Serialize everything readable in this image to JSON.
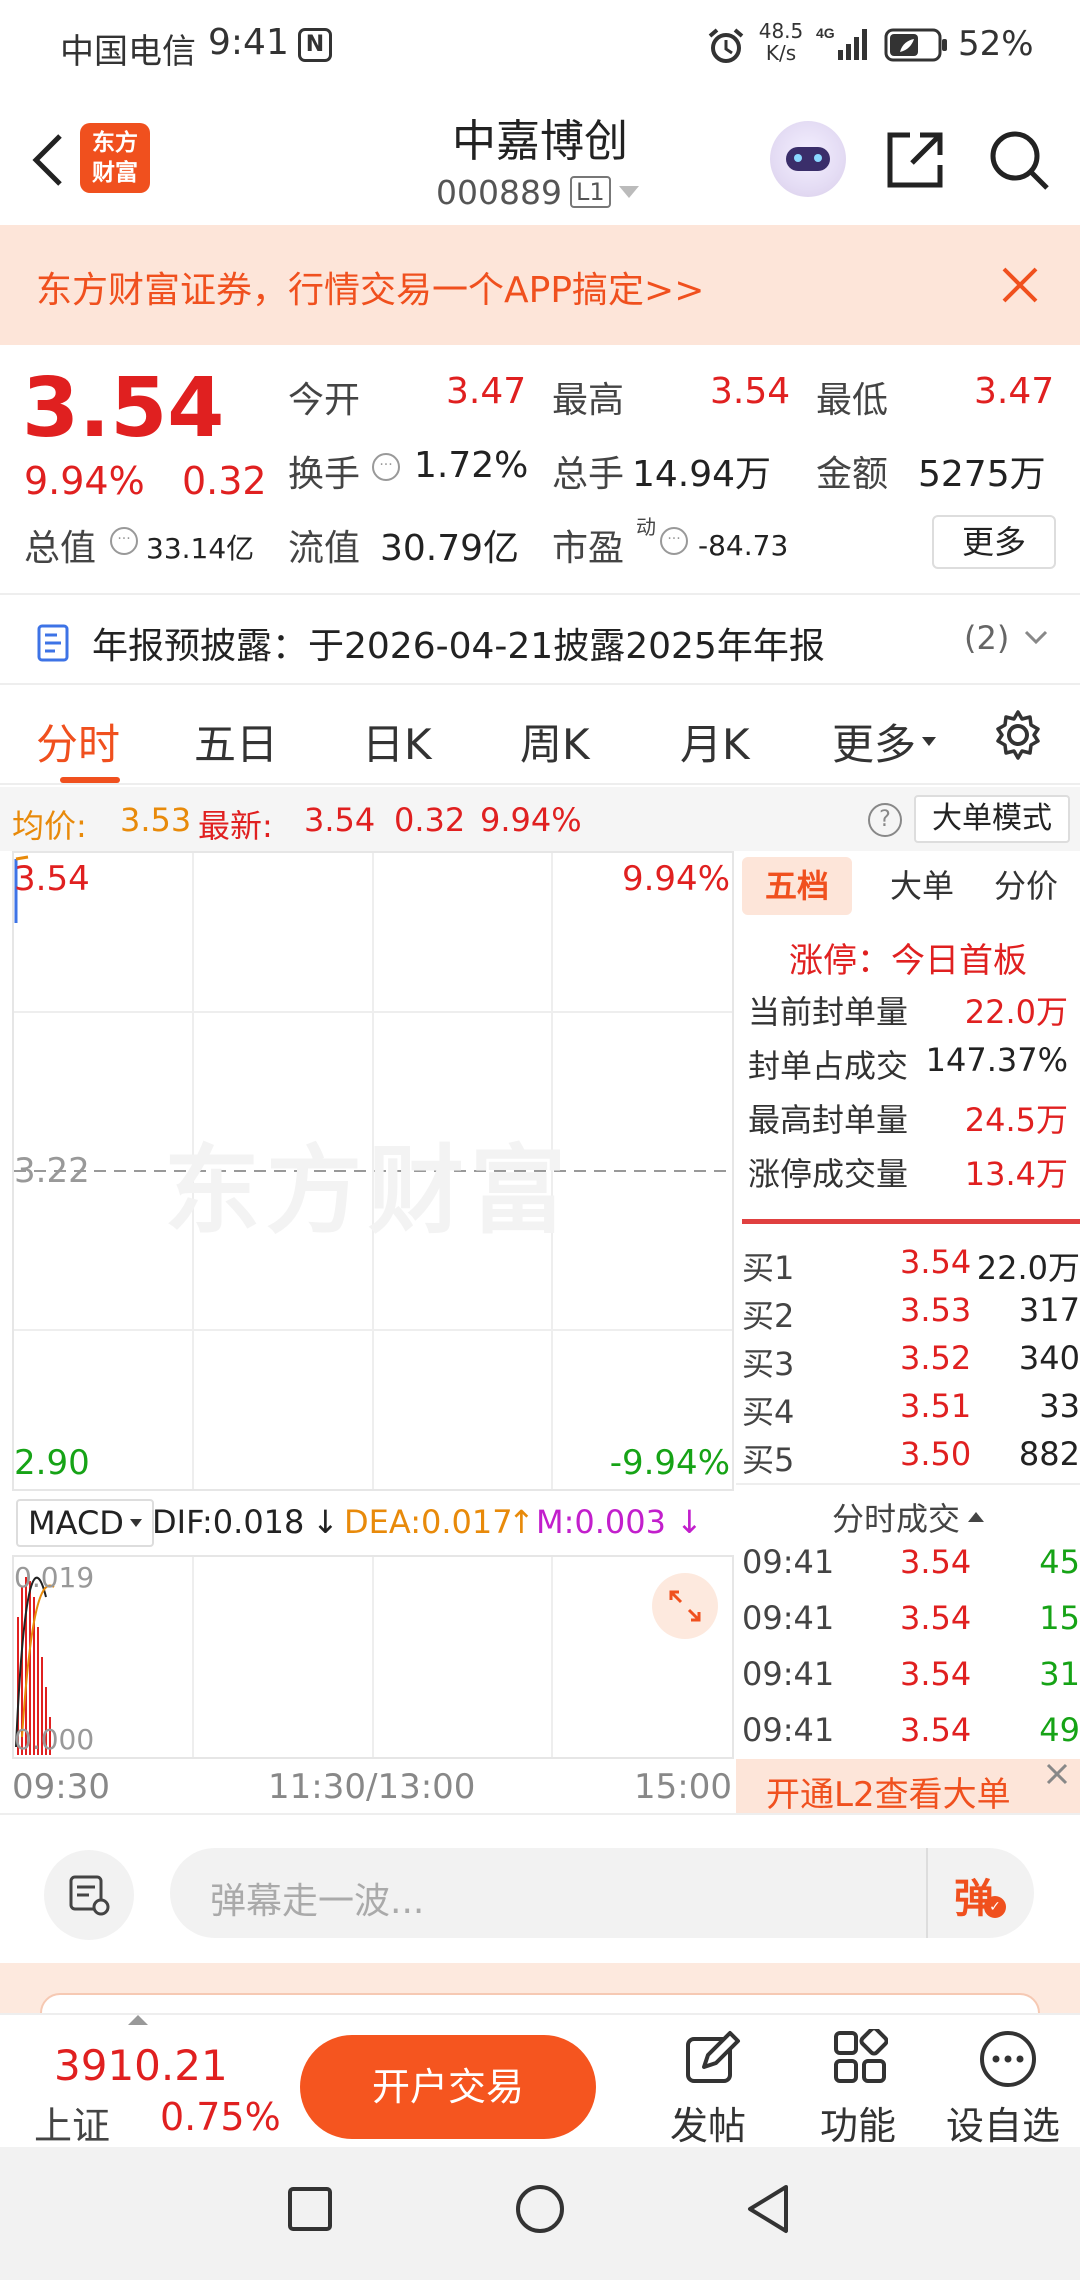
{
  "status_bar": {
    "carrier": "中国电信",
    "time": "9:41",
    "net_speed_top": "48.5",
    "net_speed_bottom": "K/s",
    "signal": "4G",
    "battery": "52%"
  },
  "header": {
    "logo_text": "东方财富",
    "stock_name": "中嘉博创",
    "stock_code": "000889",
    "level": "L1"
  },
  "promo": {
    "text": "东方财富证券，行情交易一个APP搞定>>"
  },
  "quote": {
    "price": "3.54",
    "change_pct": "9.94%",
    "change": "0.32",
    "open_label": "今开",
    "open": "3.47",
    "high_label": "最高",
    "high": "3.54",
    "low_label": "最低",
    "low": "3.47",
    "turnover_label": "换手",
    "turnover": "1.72%",
    "volume_label": "总手",
    "volume": "14.94万",
    "amount_label": "金额",
    "amount": "5275万",
    "mktcap_label": "总值",
    "mktcap": "33.14亿",
    "float_label": "流值",
    "float_cap": "30.79亿",
    "pe_label": "市盈",
    "pe_sup": "动",
    "pe": "-84.73",
    "more_label": "更多"
  },
  "notice": {
    "text": "年报预披露：于2026-04-21披露2025年年报",
    "count": "(2)"
  },
  "tabs": {
    "t1": "分时",
    "t2": "五日",
    "t3": "日K",
    "t4": "周K",
    "t5": "月K",
    "t6": "更多"
  },
  "chart_info": {
    "avg_label": "均价:",
    "avg": "3.53",
    "latest_label": "最新:",
    "latest": "3.54",
    "chg": "0.32",
    "pct": "9.94%",
    "mode_label": "大单模式"
  },
  "chart_data": {
    "type": "line",
    "ylim": [
      2.9,
      3.54
    ],
    "y_ticks_left": [
      "3.54",
      "3.22",
      "2.90"
    ],
    "y_ticks_right": [
      "9.94%",
      "-9.94%"
    ],
    "x_ticks": [
      "09:30",
      "11:30/13:00",
      "15:00"
    ],
    "watermark": "东方财富",
    "macd": {
      "selector": "MACD",
      "dif_label": "DIF:0.018",
      "dea_label": "DEA:0.017",
      "m_label": "M:0.003",
      "ylim_top": "0.019",
      "ylim_bottom": "0.000"
    }
  },
  "side": {
    "tab1": "五档",
    "tab2": "大单",
    "tab3": "分价",
    "limit_title": "涨停：今日首板",
    "rows": [
      {
        "label": "当前封单量",
        "value": "22.0万"
      },
      {
        "label": "封单占成交",
        "value": "147.37%"
      },
      {
        "label": "最高封单量",
        "value": "24.5万"
      },
      {
        "label": "涨停成交量",
        "value": "13.4万"
      }
    ],
    "bids": [
      {
        "label": "买1",
        "price": "3.54",
        "vol": "22.0万"
      },
      {
        "label": "买2",
        "price": "3.53",
        "vol": "317"
      },
      {
        "label": "买3",
        "price": "3.52",
        "vol": "340"
      },
      {
        "label": "买4",
        "price": "3.51",
        "vol": "33"
      },
      {
        "label": "买5",
        "price": "3.50",
        "vol": "882"
      }
    ],
    "ticks_title": "分时成交",
    "ticks": [
      {
        "time": "09:41",
        "price": "3.54",
        "vol": "45"
      },
      {
        "time": "09:41",
        "price": "3.54",
        "vol": "15"
      },
      {
        "time": "09:41",
        "price": "3.54",
        "vol": "31"
      },
      {
        "time": "09:41",
        "price": "3.54",
        "vol": "49"
      }
    ],
    "l2_banner": "开通L2查看大单"
  },
  "danmu": {
    "placeholder": "弹幕走一波...",
    "send_label": "弹"
  },
  "bottom": {
    "index_value": "3910.21",
    "index_name": "上证",
    "index_pct": "0.75%",
    "trade_label": "开户交易",
    "post_label": "发帖",
    "func_label": "功能",
    "watch_label": "设自选"
  }
}
